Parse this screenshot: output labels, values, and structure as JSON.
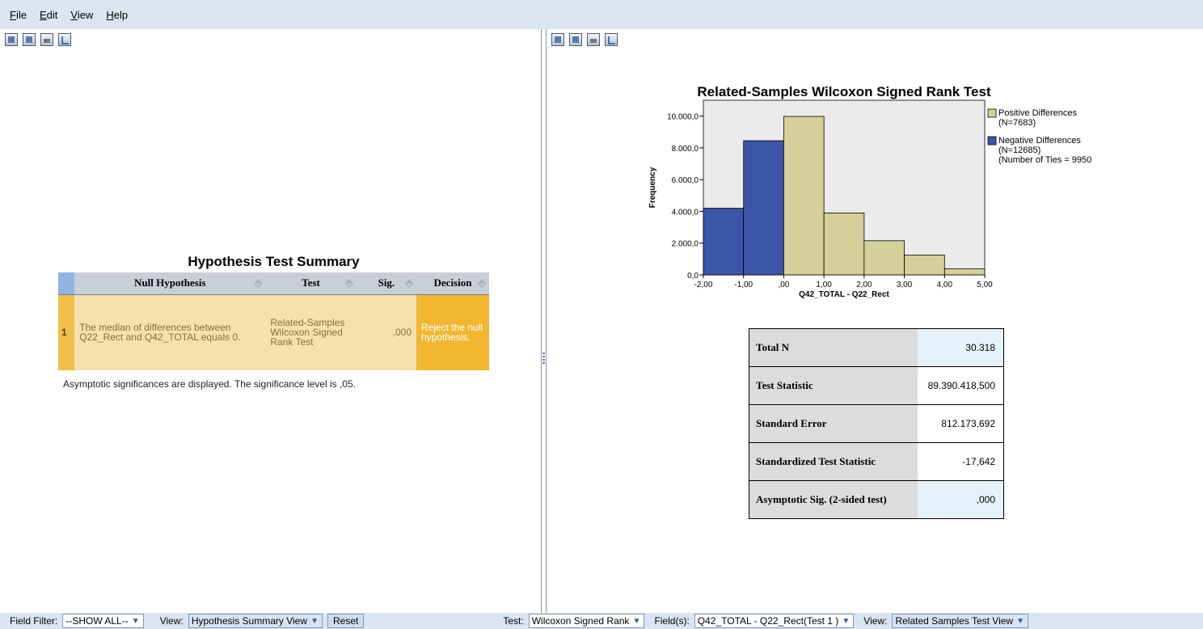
{
  "menu": [
    "File",
    "Edit",
    "View",
    "Help"
  ],
  "left": {
    "table_title": "Hypothesis Test Summary",
    "headers": [
      "Null Hypothesis",
      "Test",
      "Sig.",
      "Decision"
    ],
    "row": {
      "index": "1",
      "null_hypothesis": "The median of differences between Q22_Rect and Q42_TOTAL equals 0.",
      "test": "Related-Samples Wilcoxon Signed Rank Test",
      "sig": ",000",
      "decision": "Reject the null hypothesis."
    },
    "note": "Asymptotic significances are displayed.  The significance level is ,05."
  },
  "chart_data": {
    "type": "bar",
    "title": "Related-Samples Wilcoxon Signed Rank Test",
    "xlabel": "Q42_TOTAL - Q22_Rect",
    "ylabel": "Frequency",
    "xlim": [
      -2,
      5
    ],
    "ylim": [
      0,
      11000
    ],
    "x_ticks": [
      "-2,00",
      "-1,00",
      ",00",
      "1,00",
      "2,00",
      "3,00",
      "4,00",
      "5,00"
    ],
    "y_ticks": [
      "0,0",
      "2.000,0",
      "4.000,0",
      "6.000,0",
      "8.000,0",
      "10.000,0"
    ],
    "bins": [
      {
        "x0": -2,
        "x1": -1,
        "value": 4200,
        "series": "negative"
      },
      {
        "x0": -1,
        "x1": 0,
        "value": 8450,
        "series": "negative"
      },
      {
        "x0": 0,
        "x1": 1,
        "value": 9980,
        "series": "positive"
      },
      {
        "x0": 1,
        "x1": 2,
        "value": 3900,
        "series": "positive"
      },
      {
        "x0": 2,
        "x1": 3,
        "value": 2150,
        "series": "positive"
      },
      {
        "x0": 3,
        "x1": 4,
        "value": 1250,
        "series": "positive"
      },
      {
        "x0": 4,
        "x1": 5,
        "value": 380,
        "series": "positive"
      }
    ],
    "legend": {
      "placement": "right",
      "items": [
        {
          "label": "Positive Differences",
          "sub": "(N=7683)",
          "color": "#d5d09a"
        },
        {
          "label": "Negative Differences",
          "sub": "(N=12685)",
          "color": "#3d55a8"
        }
      ],
      "ties_note": "(Number of Ties = 9950"
    },
    "colors": {
      "positive": "#d5d09a",
      "negative": "#3d55a8",
      "plot_bg": "#ebebeb"
    }
  },
  "stats": [
    {
      "label": "Total N",
      "value": "30.318",
      "highlight": true
    },
    {
      "label": "Test Statistic",
      "value": "89.390.418,500",
      "highlight": false
    },
    {
      "label": "Standard Error",
      "value": "812.173,692",
      "highlight": false
    },
    {
      "label": "Standardized Test Statistic",
      "value": "-17,642",
      "highlight": false
    },
    {
      "label": "Asymptotic Sig. (2-sided test)",
      "value": ",000",
      "highlight": true
    }
  ],
  "statusbar": {
    "field_filter_label": "Field Filter:",
    "field_filter_value": "--SHOW ALL--",
    "left_view_label": "View:",
    "left_view_value": "Hypothesis Summary View",
    "reset_label": "Reset",
    "test_label": "Test:",
    "test_value": "Wilcoxon Signed Rank",
    "fields_label": "Field(s):",
    "fields_value": "Q42_TOTAL - Q22_Rect(Test 1 )",
    "right_view_label": "View:",
    "right_view_value": "Related Samples Test View"
  }
}
